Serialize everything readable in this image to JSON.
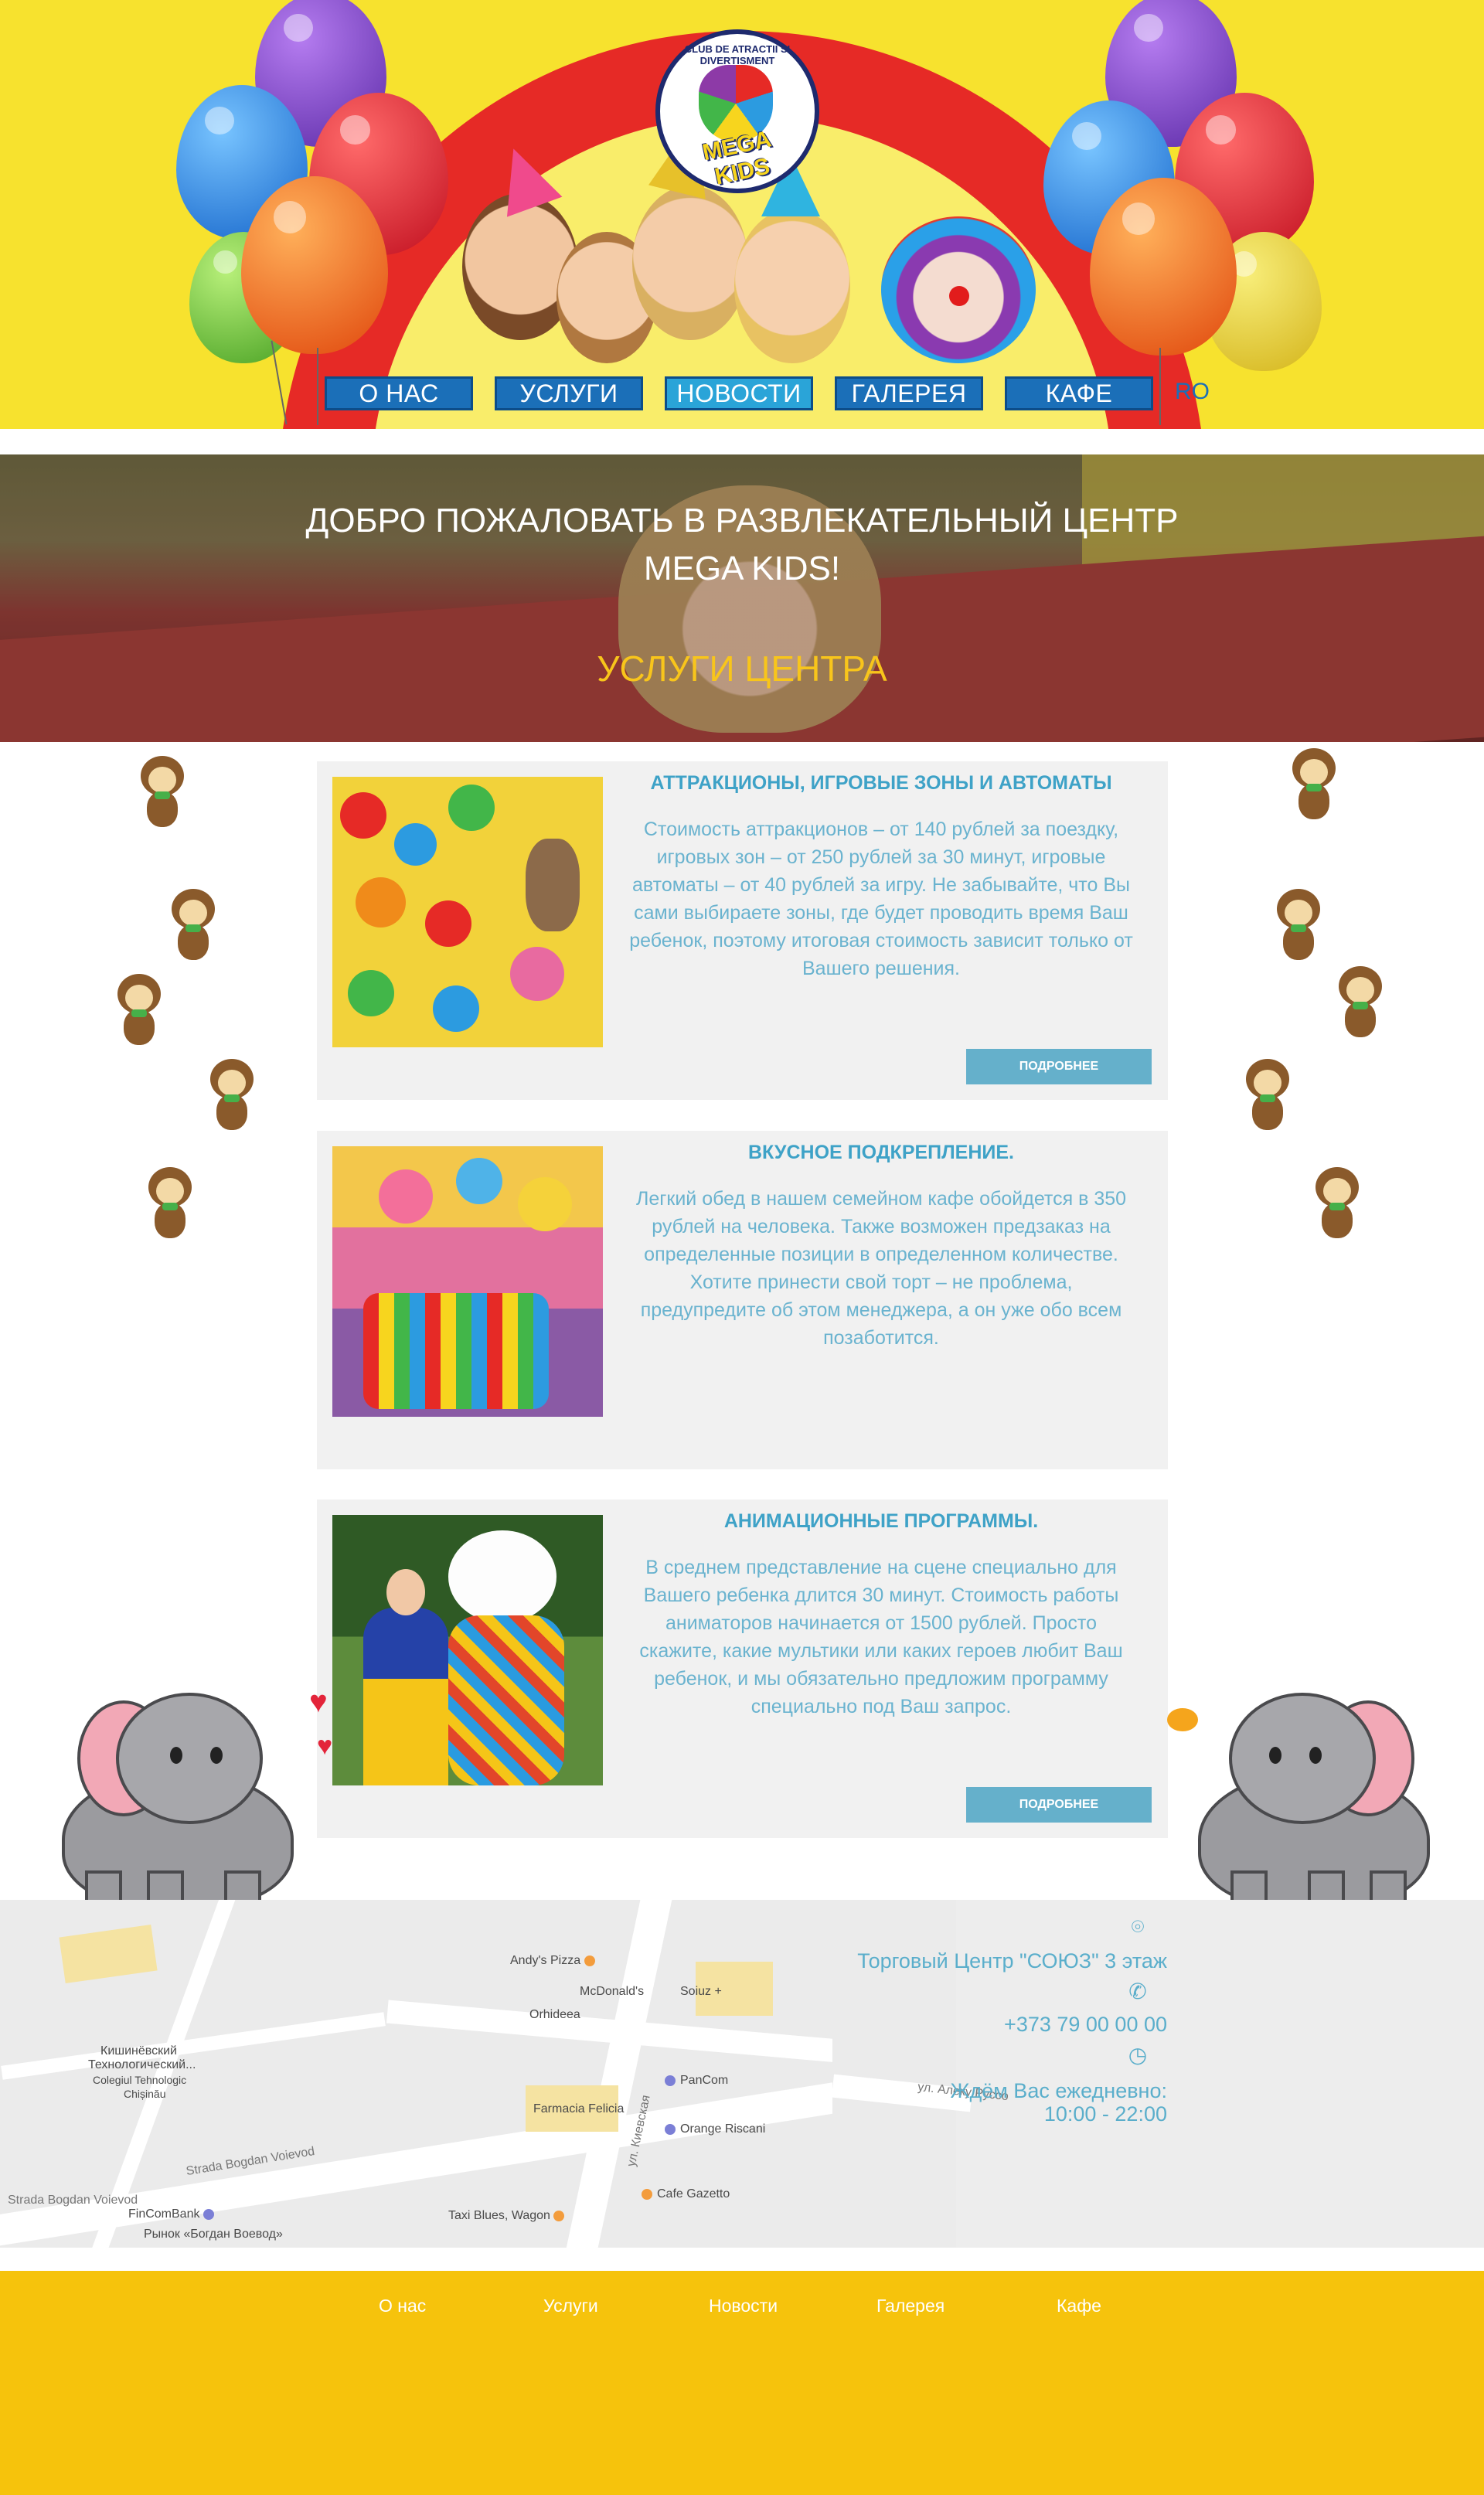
{
  "brand": {
    "ring_text": "CLUB DE ATRACTII SI DIVERTISMENT",
    "logo_word": "MEGA KIDS"
  },
  "nav": {
    "items": [
      "О НАС",
      "УСЛУГИ",
      "НОВОСТИ",
      "ГАЛЕРЕЯ",
      "КАФЕ"
    ],
    "lang": "RO"
  },
  "hero": {
    "title_line1": "ДОБРО ПОЖАЛОВАТЬ В РАЗВЛЕКАТЕЛЬНЫЙ ЦЕНТР",
    "title_line2": "MEGA KIDS!",
    "subtitle": "УСЛУГИ ЦЕНТРА"
  },
  "services": [
    {
      "title": "АТТРАКЦИОНЫ, ИГРОВЫЕ ЗОНЫ И АВТОМАТЫ",
      "text": "Стоимость аттракционов – от 140 рублей за поездку, игровых зон – от 250 рублей за 30 минут, игровые автоматы – от 40 рублей за игру. Не забывайте, что Вы сами выбираете зоны, где будет проводить время Ваш ребенок, поэтому итоговая стоимость зависит только от Вашего решения.",
      "button": "ПОДРОБНЕЕ"
    },
    {
      "title": "ВКУСНОЕ ПОДКРЕПЛЕНИЕ.",
      "text": "Легкий обед в нашем семейном кафе обойдется в 350 рублей на человека. Также возможен предзаказ на определенные позиции в определенном количестве. Хотите принести свой торт – не проблема, предупредите об этом менеджера, а он уже обо всем позаботится."
    },
    {
      "title": "АНИМАЦИОННЫЕ ПРОГРАММЫ.",
      "text": "В среднем представление на сцене специально для Вашего ребенка длится 30 минут. Стоимость работы аниматоров начинается от 1500 рублей. Просто скажите, какие мультики или каких героев любит Ваш ребенок, и мы обязательно предложим программу специально под Ваш запрос.",
      "button": "ПОДРОБНЕЕ"
    }
  ],
  "map": {
    "labels": {
      "andys": "Andy's Pizza",
      "mcd": "McDonald's",
      "soiuz": "Soiuz +",
      "orhideea": "Orhideea",
      "pancom": "PanCom",
      "felicia": "Farmacia Felicia",
      "orange": "Orange Riscani",
      "gazetto": "Cafe Gazetto",
      "taxi": "Taxi Blues, Wagon",
      "fincom": "FinComBank",
      "market": "Рынок «Богдан Воевод»",
      "college1": "Кишинёвский",
      "college2": "Технологический...",
      "college3": "Colegiul Tehnologic",
      "college4": "Chișinău",
      "street1": "Strada Bogdan Voievod",
      "street2": "Strada Bogdan Voievod",
      "street3": "ул. Киевская",
      "street4": "ул. Алеку Руссо"
    }
  },
  "contacts": {
    "address": "Торговый Центр \"СОЮЗ\"  3 этаж",
    "phone": "+373 79 00 00 00",
    "hours_label": "Ждём Вас ежедневно:",
    "hours": "10:00 - 22:00",
    "icons": [
      "location-pin-icon",
      "phone-icon",
      "clock-icon"
    ]
  },
  "footer": {
    "links": [
      "О нас",
      "Услуги",
      "Новости",
      "Галерея",
      "Кафе"
    ]
  },
  "colors": {
    "header_bg": "#f7e22e",
    "nav_blue": "#1b6fb8",
    "accent_yellow": "#f8c51b",
    "service_title": "#3ea2c7",
    "button": "#65b0cb",
    "footer_bg": "#f6c30c"
  }
}
